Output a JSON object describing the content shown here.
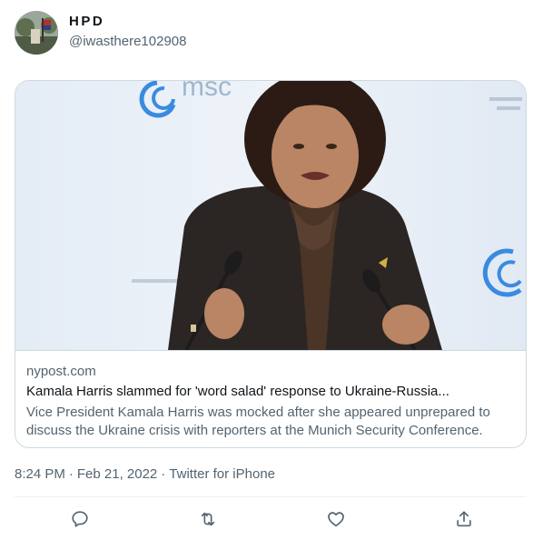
{
  "user": {
    "display_name": "HPD",
    "handle": "@iwasthere102908"
  },
  "card": {
    "domain": "nypost.com",
    "title": "Kamala Harris slammed for 'word salad' response to Ukraine-Russia...",
    "description": "Vice President Kamala Harris was mocked after she appeared unprepared to discuss the Ukraine crisis with reporters at the Munich Security Conference.",
    "image_logo_text": "msc"
  },
  "meta": {
    "time": "8:24 PM",
    "date": "Feb 21, 2022",
    "source": "Twitter for iPhone"
  },
  "actions": [
    {
      "icon": "reply-icon"
    },
    {
      "icon": "retweet-icon"
    },
    {
      "icon": "like-icon"
    },
    {
      "icon": "share-icon"
    }
  ],
  "colors": {
    "text_primary": "#0f1419",
    "text_secondary": "#536471",
    "border": "#cfd9de"
  }
}
